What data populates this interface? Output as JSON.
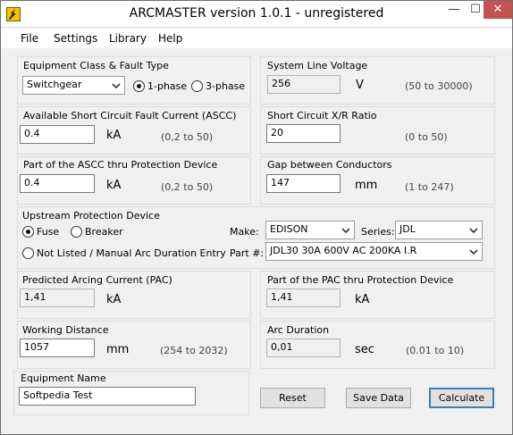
{
  "window": {
    "title": "ARCMASTER version 1.0.1 - unregistered"
  },
  "window_controls": {
    "minimize": "—",
    "maximize": "☐",
    "close": "✕"
  },
  "menu": {
    "file": "File",
    "settings": "Settings",
    "library": "Library",
    "help": "Help"
  },
  "equipment": {
    "title": "Equipment Class & Fault Type",
    "class_value": "Switchgear",
    "phase1_label": "1-phase",
    "phase3_label": "3-phase",
    "selected_phase": "1-phase"
  },
  "voltage": {
    "title": "System Line Voltage",
    "value": "256",
    "unit": "V",
    "range": "(50 to 30000)"
  },
  "ascc": {
    "title": "Available Short Circuit Fault Current (ASCC)",
    "value": "0.4",
    "unit": "kA",
    "range": "(0,2 to 50)"
  },
  "xr": {
    "title": "Short Circuit X/R Ratio",
    "value": "20",
    "range": "(0 to 50)"
  },
  "part_ascc": {
    "title": "Part of the ASCC thru Protection Device",
    "value": "0.4",
    "unit": "kA",
    "range": "(0,2 to 50)"
  },
  "gap": {
    "title": "Gap between Conductors",
    "value": "147",
    "unit": "mm",
    "range": "(1 to 247)"
  },
  "upstream": {
    "title": "Upstream Protection Device",
    "fuse_label": "Fuse",
    "breaker_label": "Breaker",
    "notlisted_label": "Not Listed / Manual Arc Duration Entry",
    "selected": "Fuse",
    "make_label": "Make:",
    "make_value": "EDISON",
    "series_label": "Series:",
    "series_value": "JDL",
    "part_label": "Part #:",
    "part_value": "JDL30 30A 600V AC 200KA I.R"
  },
  "pac": {
    "title": "Predicted Arcing Current (PAC)",
    "value": "1,41",
    "unit": "kA"
  },
  "part_pac": {
    "title": "Part of the PAC thru Protection Device",
    "value": "1,41",
    "unit": "kA"
  },
  "working": {
    "title": "Working Distance",
    "value": "1057",
    "unit": "mm",
    "range": "(254 to 2032)"
  },
  "arc": {
    "title": "Arc Duration",
    "value": "0,01",
    "unit": "sec",
    "range": "(0.01 to 10)"
  },
  "equip_name": {
    "title": "Equipment Name",
    "value": "Softpedia Test"
  },
  "buttons": {
    "reset": "Reset",
    "save": "Save Data",
    "calculate": "Calculate"
  },
  "colors": {
    "window_bg": "#f0f0f0",
    "close_button": "#c75050",
    "default_button_border": "#3c7fb1"
  }
}
